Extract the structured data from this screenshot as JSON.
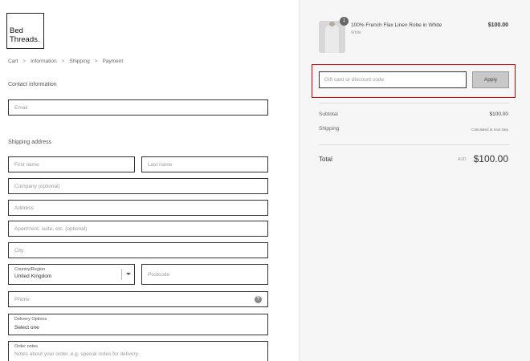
{
  "brand": {
    "logo_line1": "Bed",
    "logo_line2": "Threads."
  },
  "breadcrumb": [
    "Cart",
    "Information",
    "Shipping",
    "Payment"
  ],
  "breadcrumb_sep": ">",
  "contact": {
    "title": "Contact information",
    "email_placeholder": "Email"
  },
  "shipping": {
    "title": "Shipping address",
    "first_name_placeholder": "First name",
    "last_name_placeholder": "Last name",
    "company_placeholder": "Company (optional)",
    "address_placeholder": "Address",
    "apartment_placeholder": "Apartment, suite, etc. (optional)",
    "city_placeholder": "City",
    "country_label": "Country/Region",
    "country_value": "United Kingdom",
    "postcode_placeholder": "Postcode",
    "phone_placeholder": "Phone",
    "phone_help_icon": "?",
    "delivery_label": "Delivery Options",
    "delivery_value": "Select one",
    "notes_label": "Order notes",
    "notes_placeholder": "Notes about your order, e.g. special notes for delivery."
  },
  "order": {
    "item_name": "100% French Flax Linen Robe in White",
    "item_variant": "White",
    "item_price": "$100.00",
    "quantity": "1",
    "discount_placeholder": "Gift card or discount code",
    "apply_label": "Apply",
    "subtotal_label": "Subtotal",
    "subtotal_value": "$100.00",
    "shipping_label": "Shipping",
    "shipping_value": "Calculated at next step",
    "total_label": "Total",
    "total_currency": "AUD",
    "total_value": "$100.00"
  },
  "colors": {
    "highlight": "#d40000",
    "right_panel_bg": "#f6f6f6",
    "button_bg": "#c8c8c8"
  },
  "icons": {
    "caret": "chevron-down-icon",
    "help": "question-circle-icon"
  }
}
